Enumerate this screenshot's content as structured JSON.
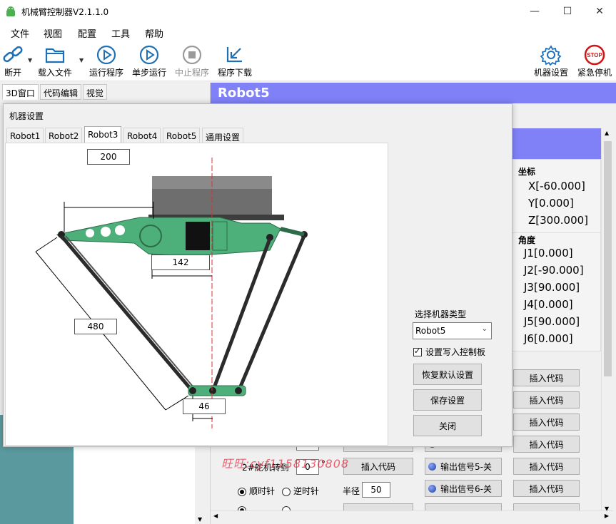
{
  "window": {
    "title": "机械臂控制器V2.1.1.0"
  },
  "menu": [
    "文件",
    "视图",
    "配置",
    "工具",
    "帮助"
  ],
  "toolbar": {
    "disconnect": "断开",
    "load_file": "载入文件",
    "run_program": "运行程序",
    "step_run": "单步运行",
    "stop_program": "中止程序",
    "download_program": "程序下载",
    "machine_settings": "机器设置",
    "emergency_stop": "紧急停机",
    "stop_sign_text": "STOP"
  },
  "left_tabs": [
    "3D窗口",
    "代码编辑",
    "视觉"
  ],
  "right": {
    "banner": "Robot5",
    "coord_title": "坐标",
    "coords": [
      "X[-60.000]",
      "Y[0.000]",
      "Z[300.000]"
    ],
    "angle_title": "角度",
    "angles": [
      "J1[0.000]",
      "J2[-90.000]",
      "J3[90.000]",
      "J4[0.000]",
      "J5[90.000]",
      "J6[0.000]"
    ],
    "insert_code": "插入代码",
    "servo2_label": "2#舵机转到",
    "servo2_value": "0",
    "servo2_unit": "°",
    "output5": "输出信号5-关",
    "output6": "输出信号6-关",
    "clockwise": "顺时针",
    "counter_clockwise": "逆时针",
    "radius_label": "半径",
    "radius_value": "50"
  },
  "dialog": {
    "title": "机器设置",
    "tabs": [
      "Robot1",
      "Robot2",
      "Robot3",
      "Robot4",
      "Robot5",
      "通用设置"
    ],
    "active_tab": 2,
    "dims": {
      "top_width": "200",
      "offset": "142",
      "arm_length": "480",
      "effector": "46"
    },
    "select_type_label": "选择机器类型",
    "selected_type": "Robot5",
    "write_board_label": "设置写入控制板",
    "restore_default": "恢复默认设置",
    "save_settings": "保存设置",
    "close": "关闭"
  },
  "watermark": "旺旺:cyf1158130808"
}
